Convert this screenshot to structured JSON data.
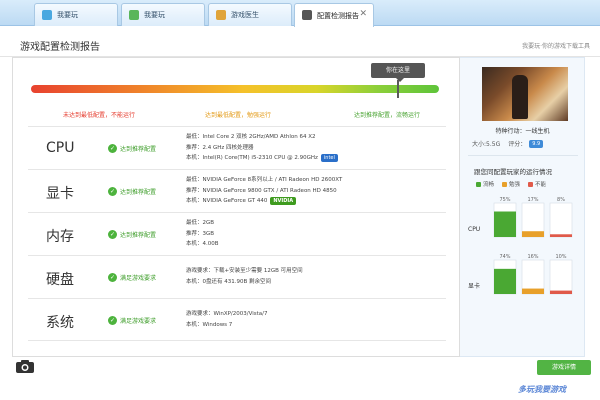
{
  "tabs": [
    {
      "label": "我要玩",
      "icon_color": "#4aa8e0"
    },
    {
      "label": "我要玩",
      "icon_color": "#5ab65a"
    },
    {
      "label": "游戏医生",
      "icon_color": "#e0a43a"
    },
    {
      "label": "配置检测报告",
      "icon_color": "#555555",
      "active": true
    }
  ],
  "header": {
    "title": "游戏配置检测报告",
    "link": "我要玩·你的游戏下载工具"
  },
  "meter": {
    "tooltip": "你在这里",
    "fill_fraction": 0.9,
    "labels": {
      "low": "未达到最低配置，不能运行",
      "mid": "达到最低配置，勉强运行",
      "high": "达到推荐配置，流畅运行"
    }
  },
  "rows": [
    {
      "name": "CPU",
      "status": "达到推荐配置",
      "lines": [
        {
          "text": "最低：Intel Core 2 双核 2GHz/AMD Athlon 64 X2"
        },
        {
          "text": "推荐：2.4 GHz 四核处理器"
        },
        {
          "text": "本机：Intel(R) Core(TM) i5-2310 CPU @ 2.90GHz",
          "badge": "intel",
          "badge_text": "intel"
        }
      ]
    },
    {
      "name": "显卡",
      "status": "达到推荐配置",
      "lines": [
        {
          "text": "最低：NVIDIA GeForce 8系列以上 / ATI Radeon HD 2600XT"
        },
        {
          "text": "推荐：NVIDIA GeForce 9800 GTX / ATI Radeon HD 4850"
        },
        {
          "text": "本机：NVIDIA GeForce GT 440",
          "badge": "nvidia",
          "badge_text": "NVIDIA"
        }
      ]
    },
    {
      "name": "内存",
      "status": "达到推荐配置",
      "lines": [
        {
          "text": "最低：2GB"
        },
        {
          "text": "推荐：3GB"
        },
        {
          "text": "本机：4.00B"
        }
      ]
    },
    {
      "name": "硬盘",
      "status": "满足游戏要求",
      "lines": [
        {
          "text": "游戏要求：下载+安装至少需要 12GB 可用空间"
        },
        {
          "text": "本机：0盘还有 431.90B 剩余空间"
        }
      ]
    },
    {
      "name": "系统",
      "status": "满足游戏要求",
      "lines": [
        {
          "text": "游戏要求：WinXP/2003/Vista/7"
        },
        {
          "text": "本机：Windows 7"
        }
      ]
    }
  ],
  "sidebar": {
    "game_name": "特种行动：一线生机",
    "size": "大小:5.5G",
    "score_label": "评分：",
    "score": "9.9",
    "compare_title": "跟您同配置玩家的运行情况",
    "legend": [
      {
        "label": "流畅",
        "color": "#4aa833"
      },
      {
        "label": "勉强",
        "color": "#e8a02a"
      },
      {
        "label": "不能",
        "color": "#e05a4a"
      }
    ]
  },
  "chart_data": {
    "type": "bar",
    "categories": [
      "CPU",
      "显卡"
    ],
    "series": [
      {
        "name": "流畅",
        "values": [
          75,
          74
        ],
        "labels": [
          "75%",
          "74%"
        ]
      },
      {
        "name": "勉强",
        "values": [
          17,
          16
        ],
        "labels": [
          "17%",
          "16%"
        ]
      },
      {
        "name": "不能",
        "values": [
          8,
          10
        ],
        "labels": [
          "8%",
          "10%"
        ]
      }
    ],
    "ylim": [
      0,
      100
    ]
  },
  "bottom": {
    "detail_button": "游戏详情",
    "watermark": "多玩我要游戏"
  }
}
